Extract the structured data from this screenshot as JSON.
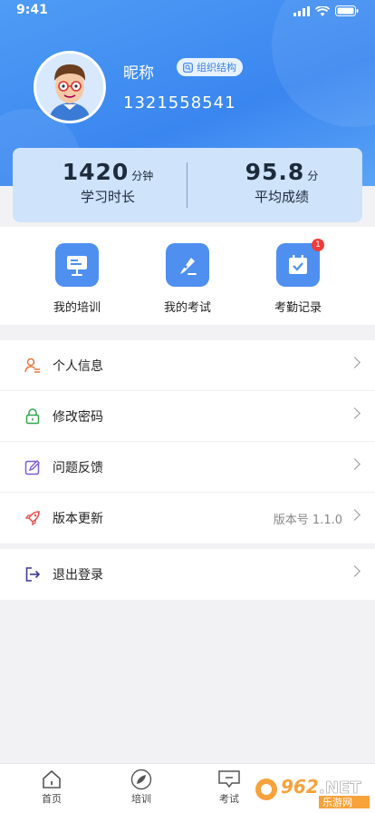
{
  "status_bar": {
    "time": "9:41"
  },
  "profile": {
    "nickname": "昵称",
    "org_button_label": "组织结构",
    "phone": "1321558541"
  },
  "stats": {
    "study_time": {
      "value": "1420",
      "unit": "分钟",
      "label": "学习时长"
    },
    "avg_score": {
      "value": "95.8",
      "unit": "分",
      "label": "平均成绩"
    }
  },
  "quick_actions": [
    {
      "label": "我的培训",
      "icon": "training-board-icon"
    },
    {
      "label": "我的考试",
      "icon": "pen-exam-icon"
    },
    {
      "label": "考勤记录",
      "icon": "calendar-check-icon",
      "badge": "1"
    }
  ],
  "menu": [
    {
      "label": "个人信息",
      "icon": "person-info-icon",
      "color": "#e8733a"
    },
    {
      "label": "修改密码",
      "icon": "lock-icon",
      "color": "#2fa84f"
    },
    {
      "label": "问题反馈",
      "icon": "edit-feedback-icon",
      "color": "#7b5bd6"
    },
    {
      "label": "版本更新",
      "icon": "rocket-icon",
      "color": "#e24a4a",
      "value": "版本号 1.1.0"
    }
  ],
  "logout": {
    "label": "退出登录",
    "icon": "logout-icon",
    "color": "#3a3a9a"
  },
  "tabbar": [
    {
      "label": "首页",
      "icon": "home-icon"
    },
    {
      "label": "培训",
      "icon": "leaf-icon"
    },
    {
      "label": "考试",
      "icon": "exam-icon"
    }
  ],
  "watermark": {
    "brand": "962",
    "suffix": ".NET",
    "sub": "乐游网"
  },
  "colors": {
    "primary": "#3a86f0",
    "badge": "#f23a3a"
  }
}
